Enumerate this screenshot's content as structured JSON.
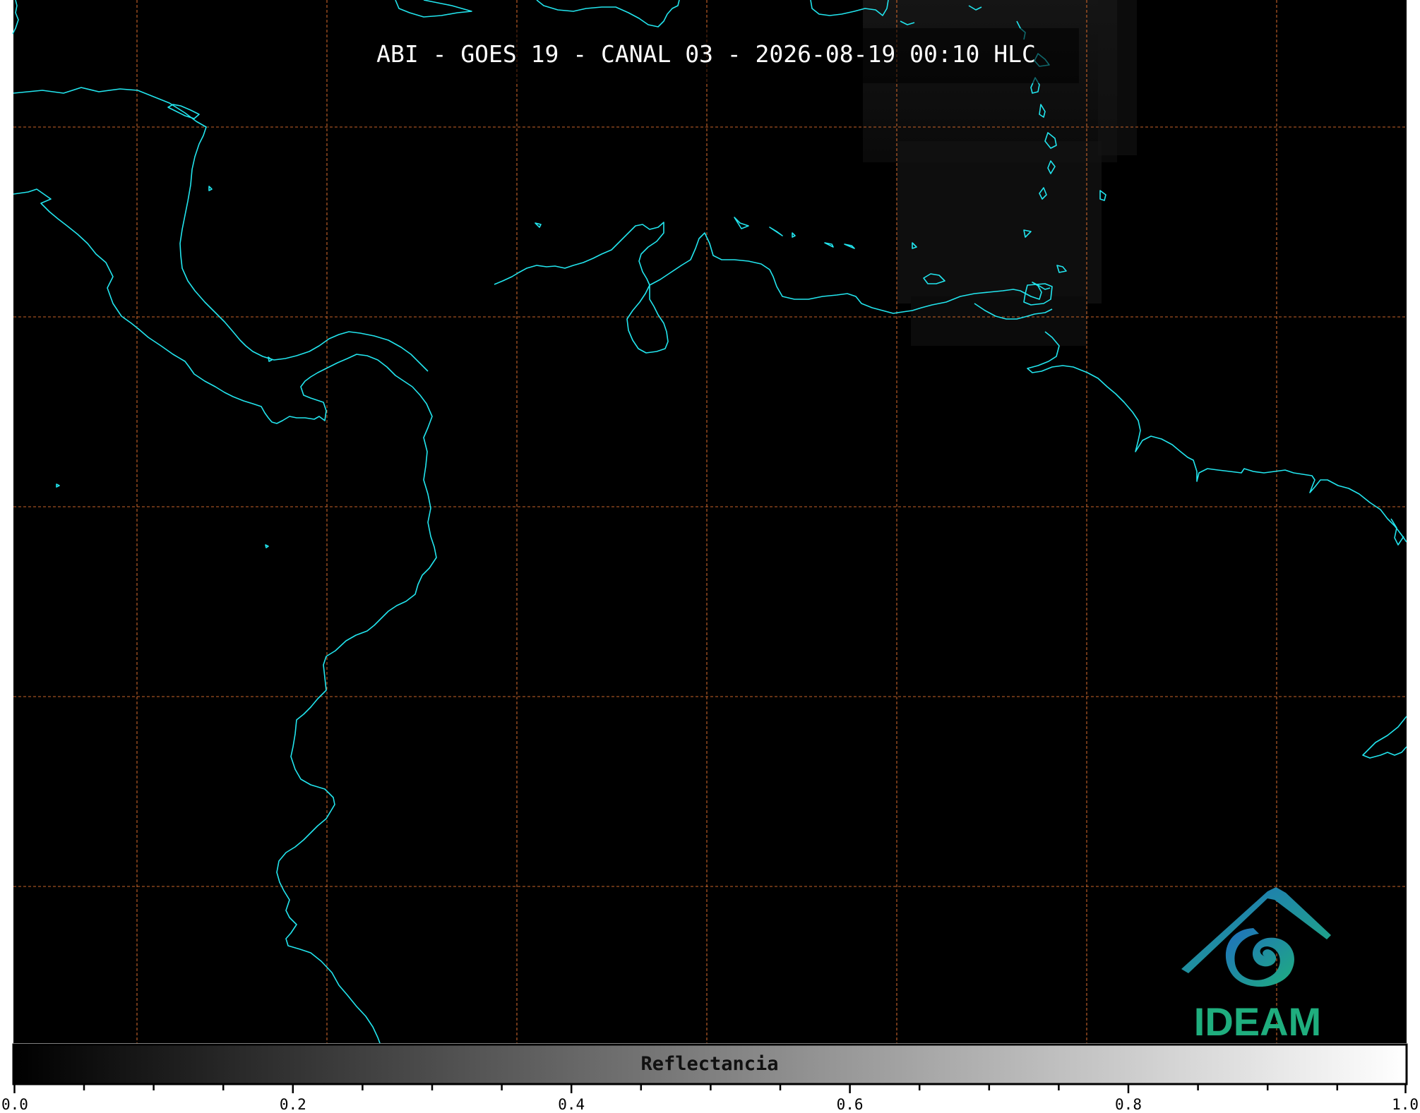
{
  "map": {
    "title": "ABI - GOES 19 - CANAL 03 - 2026-08-19 00:10 HLC",
    "background_color": "#000000",
    "coastline_color": "#22e5ee",
    "graticule_color": "#c8642a"
  },
  "colorbar": {
    "label": "Reflectancia",
    "ticks": [
      "0.0",
      "0.2",
      "0.4",
      "0.6",
      "0.8",
      "1.0"
    ],
    "range": [
      0.0,
      1.0
    ],
    "colormap": "grayscale black-to-white"
  },
  "logo": {
    "text": "IDEAM",
    "text_color": "#1fae7e",
    "mark_color": "#1f86b8"
  }
}
